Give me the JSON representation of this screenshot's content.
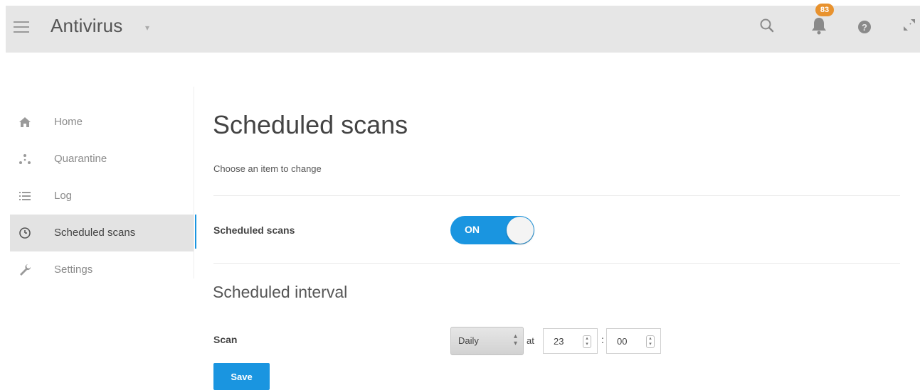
{
  "header": {
    "title": "Antivirus",
    "title_caret": "▾",
    "notification_count": "83",
    "icons": [
      "menu-icon",
      "search-icon",
      "bell-icon",
      "help-icon",
      "expand-icon"
    ]
  },
  "sidebar": {
    "items": [
      {
        "label": "Home",
        "icon": "home-icon",
        "active": false
      },
      {
        "label": "Quarantine",
        "icon": "quarantine-icon",
        "active": false
      },
      {
        "label": "Log",
        "icon": "list-icon",
        "active": false
      },
      {
        "label": "Scheduled scans",
        "icon": "clock-icon",
        "active": true
      },
      {
        "label": "Settings",
        "icon": "wrench-icon",
        "active": false
      }
    ]
  },
  "main": {
    "title": "Scheduled scans",
    "subtitle": "Choose an item to change",
    "scheduled_scans": {
      "label": "Scheduled scans",
      "toggle_text": "ON",
      "enabled": true
    },
    "interval": {
      "title": "Scheduled interval",
      "scan_label": "Scan",
      "frequency": "Daily",
      "at_label": "at",
      "hour": "23",
      "minute": "00",
      "separator": ":"
    },
    "save_label": "Save"
  },
  "colors": {
    "accent": "#1a95e0",
    "badge": "#e8922e",
    "topbar": "#e6e6e6"
  }
}
